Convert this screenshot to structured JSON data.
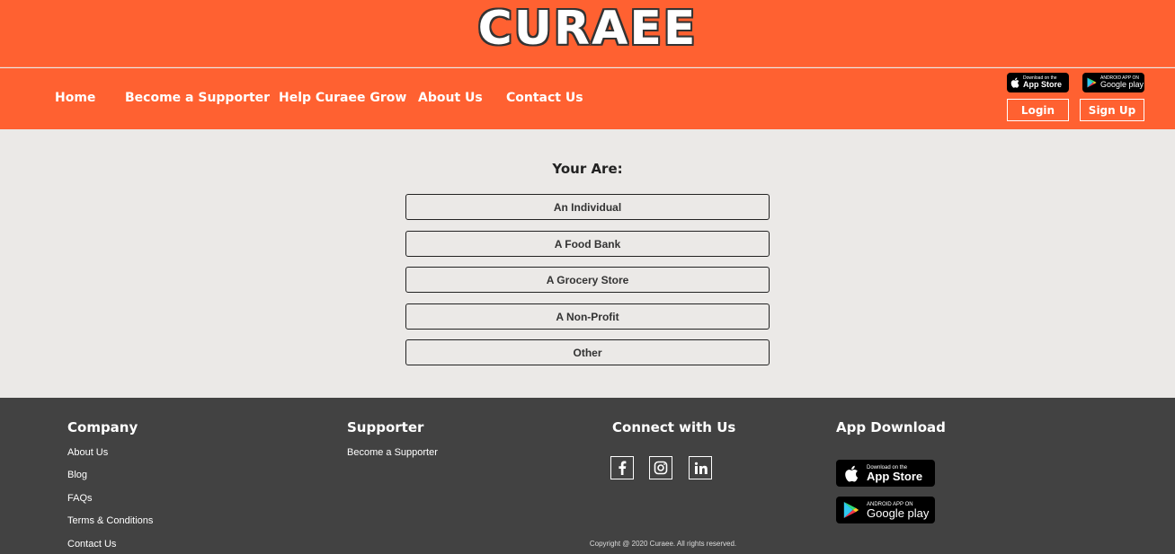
{
  "brand": {
    "logo_text": "CURAEE",
    "primary_color": "#ff6131",
    "footer_color": "#424242"
  },
  "nav": {
    "items": [
      "Home",
      "Become a Supporter",
      "Help Curaee Grow",
      "About Us",
      "Contact Us"
    ],
    "login_label": "Login",
    "signup_label": "Sign Up",
    "app_store": {
      "sub": "Download on the",
      "main": "App Store",
      "icon": "apple-icon"
    },
    "google_play": {
      "sub": "ANDROID APP ON",
      "main": "Google play",
      "icon": "google-play-icon"
    }
  },
  "main": {
    "question": "Your Are:",
    "options": [
      "An Individual",
      "A Food Bank",
      "A Grocery Store",
      "A Non-Profit",
      "Other"
    ]
  },
  "footer": {
    "company": {
      "heading": "Company",
      "links": [
        "About Us",
        "Blog",
        "FAQs",
        "Terms & Conditions",
        "Contact Us"
      ]
    },
    "supporter": {
      "heading": "Supporter",
      "links": [
        "Become a Supporter"
      ]
    },
    "connect": {
      "heading": "Connect with Us",
      "icons": [
        "facebook-icon",
        "instagram-icon",
        "linkedin-icon"
      ]
    },
    "app_download": {
      "heading": "App Download",
      "app_store": {
        "sub": "Download on the",
        "main": "App Store"
      },
      "google_play": {
        "sub": "ANDROID APP ON",
        "main": "Google play"
      }
    },
    "copyright": "Copyright @ 2020 Curaee. All rights reserved."
  }
}
